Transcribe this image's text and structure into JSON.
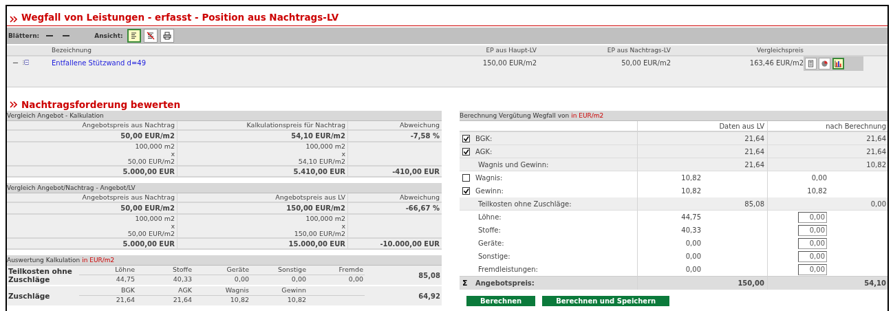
{
  "title": "Wegfall von Leistungen - erfasst - Position aus Nachtrags-LV",
  "toolbar": {
    "browse_label": "Blättern:",
    "view_label": "Ansicht:",
    "view_buttons": [
      {
        "kind": "list",
        "selected": true
      },
      {
        "kind": "list-off",
        "selected": false
      },
      {
        "kind": "print",
        "selected": false
      }
    ]
  },
  "positions": {
    "columns": [
      "Bezeichnung",
      "EP aus Haupt-LV",
      "EP aus Nachtrags-LV",
      "Vergleichspreis"
    ],
    "rows": [
      {
        "expanded": true,
        "name": "Entfallene Stützwand d=49",
        "ep_haupt": "150,00 EUR/m2",
        "ep_nachtrag": "50,00 EUR/m2",
        "vergleichspreis": "163,46 EUR/m2",
        "actions": [
          {
            "kind": "calculator",
            "selected": false
          },
          {
            "kind": "pie",
            "selected": false
          },
          {
            "kind": "bars",
            "selected": true
          }
        ]
      }
    ]
  },
  "section_title": "Nachtragsforderung bewerten",
  "comparisons": [
    {
      "title": "Vergleich Angebot - Kalkulation",
      "columns": [
        "Angebotspreis aus Nachtrag",
        "Kalkulationspreis für Nachtrag",
        "Abweichung"
      ],
      "price": [
        "50,00 EUR/m2",
        "54,10 EUR/m2",
        "-7,58 %"
      ],
      "details": [
        [
          "100,000 m2",
          "x",
          "50,00 EUR/m2"
        ],
        [
          "100,000 m2",
          "x",
          "54,10 EUR/m2"
        ]
      ],
      "totals": [
        "5.000,00 EUR",
        "5.410,00 EUR",
        "-410,00 EUR"
      ]
    },
    {
      "title": "Vergleich Angebot/Nachtrag - Angebot/LV",
      "columns": [
        "Angebotspreis aus Nachtrag",
        "Angebotspreis aus LV",
        "Abweichung"
      ],
      "price": [
        "50,00 EUR/m2",
        "150,00 EUR/m2",
        "-66,67 %"
      ],
      "details": [
        [
          "100,000 m2",
          "x",
          "50,00 EUR/m2"
        ],
        [
          "100,000 m2",
          "x",
          "150,00 EUR/m2"
        ]
      ],
      "totals": [
        "5.000,00 EUR",
        "15.000,00 EUR",
        "-10.000,00 EUR"
      ]
    }
  ],
  "auswertung": {
    "title": "Auswertung Kalkulation",
    "unit": "in EUR/m2",
    "rows": [
      {
        "label": "Teilkosten ohne Zuschläge",
        "items": [
          {
            "head": "Löhne",
            "value": "44,75"
          },
          {
            "head": "Stoffe",
            "value": "40,33"
          },
          {
            "head": "Geräte",
            "value": "0,00"
          },
          {
            "head": "Sonstige",
            "value": "0,00"
          },
          {
            "head": "Fremde",
            "value": "0,00"
          }
        ],
        "total": "85,08"
      },
      {
        "label": "Zuschläge",
        "items": [
          {
            "head": "BGK",
            "value": "21,64"
          },
          {
            "head": "AGK",
            "value": "21,64"
          },
          {
            "head": "Wagnis",
            "value": "10,82"
          },
          {
            "head": "Gewinn",
            "value": "10,82"
          }
        ],
        "total": "64,92"
      }
    ]
  },
  "berechnung": {
    "title": "Berechnung Vergütung Wegfall von",
    "unit": "in EUR/m2",
    "columns": [
      "Daten aus LV",
      "nach Berechnung"
    ],
    "rows": [
      {
        "kind": "check",
        "checked": true,
        "label": "BGK:",
        "lv": "21,64",
        "calc": "21,64"
      },
      {
        "kind": "check",
        "checked": true,
        "label": "AGK:",
        "lv": "21,64",
        "calc": "21,64"
      },
      {
        "kind": "group",
        "label": "Wagnis und Gewinn:",
        "lv": "21,64",
        "calc": "10,82"
      },
      {
        "kind": "item_check",
        "checked": false,
        "label": "Wagnis:",
        "lv": "10,82",
        "calc": "0,00"
      },
      {
        "kind": "item_check",
        "checked": true,
        "label": "Gewinn:",
        "lv": "10,82",
        "calc": "10,82"
      },
      {
        "kind": "group",
        "label": "Teilkosten ohne Zuschläge:",
        "lv": "85,08",
        "calc": "0,00"
      },
      {
        "kind": "item_input",
        "label": "Löhne:",
        "lv": "44,75",
        "calc": "0,00"
      },
      {
        "kind": "item_input",
        "label": "Stoffe:",
        "lv": "40,33",
        "calc": "0,00"
      },
      {
        "kind": "item_input",
        "label": "Geräte:",
        "lv": "0,00",
        "calc": "0,00"
      },
      {
        "kind": "item_input",
        "label": "Sonstige:",
        "lv": "0,00",
        "calc": "0,00"
      },
      {
        "kind": "item_input",
        "label": "Fremdleistungen:",
        "lv": "0,00",
        "calc": "0,00"
      },
      {
        "kind": "sum",
        "symbol": "Σ",
        "label": "Angebotspreis:",
        "lv": "150,00",
        "calc": "54,10"
      }
    ]
  },
  "buttons": [
    "Berechnen",
    "Berechnen und Speichern"
  ]
}
